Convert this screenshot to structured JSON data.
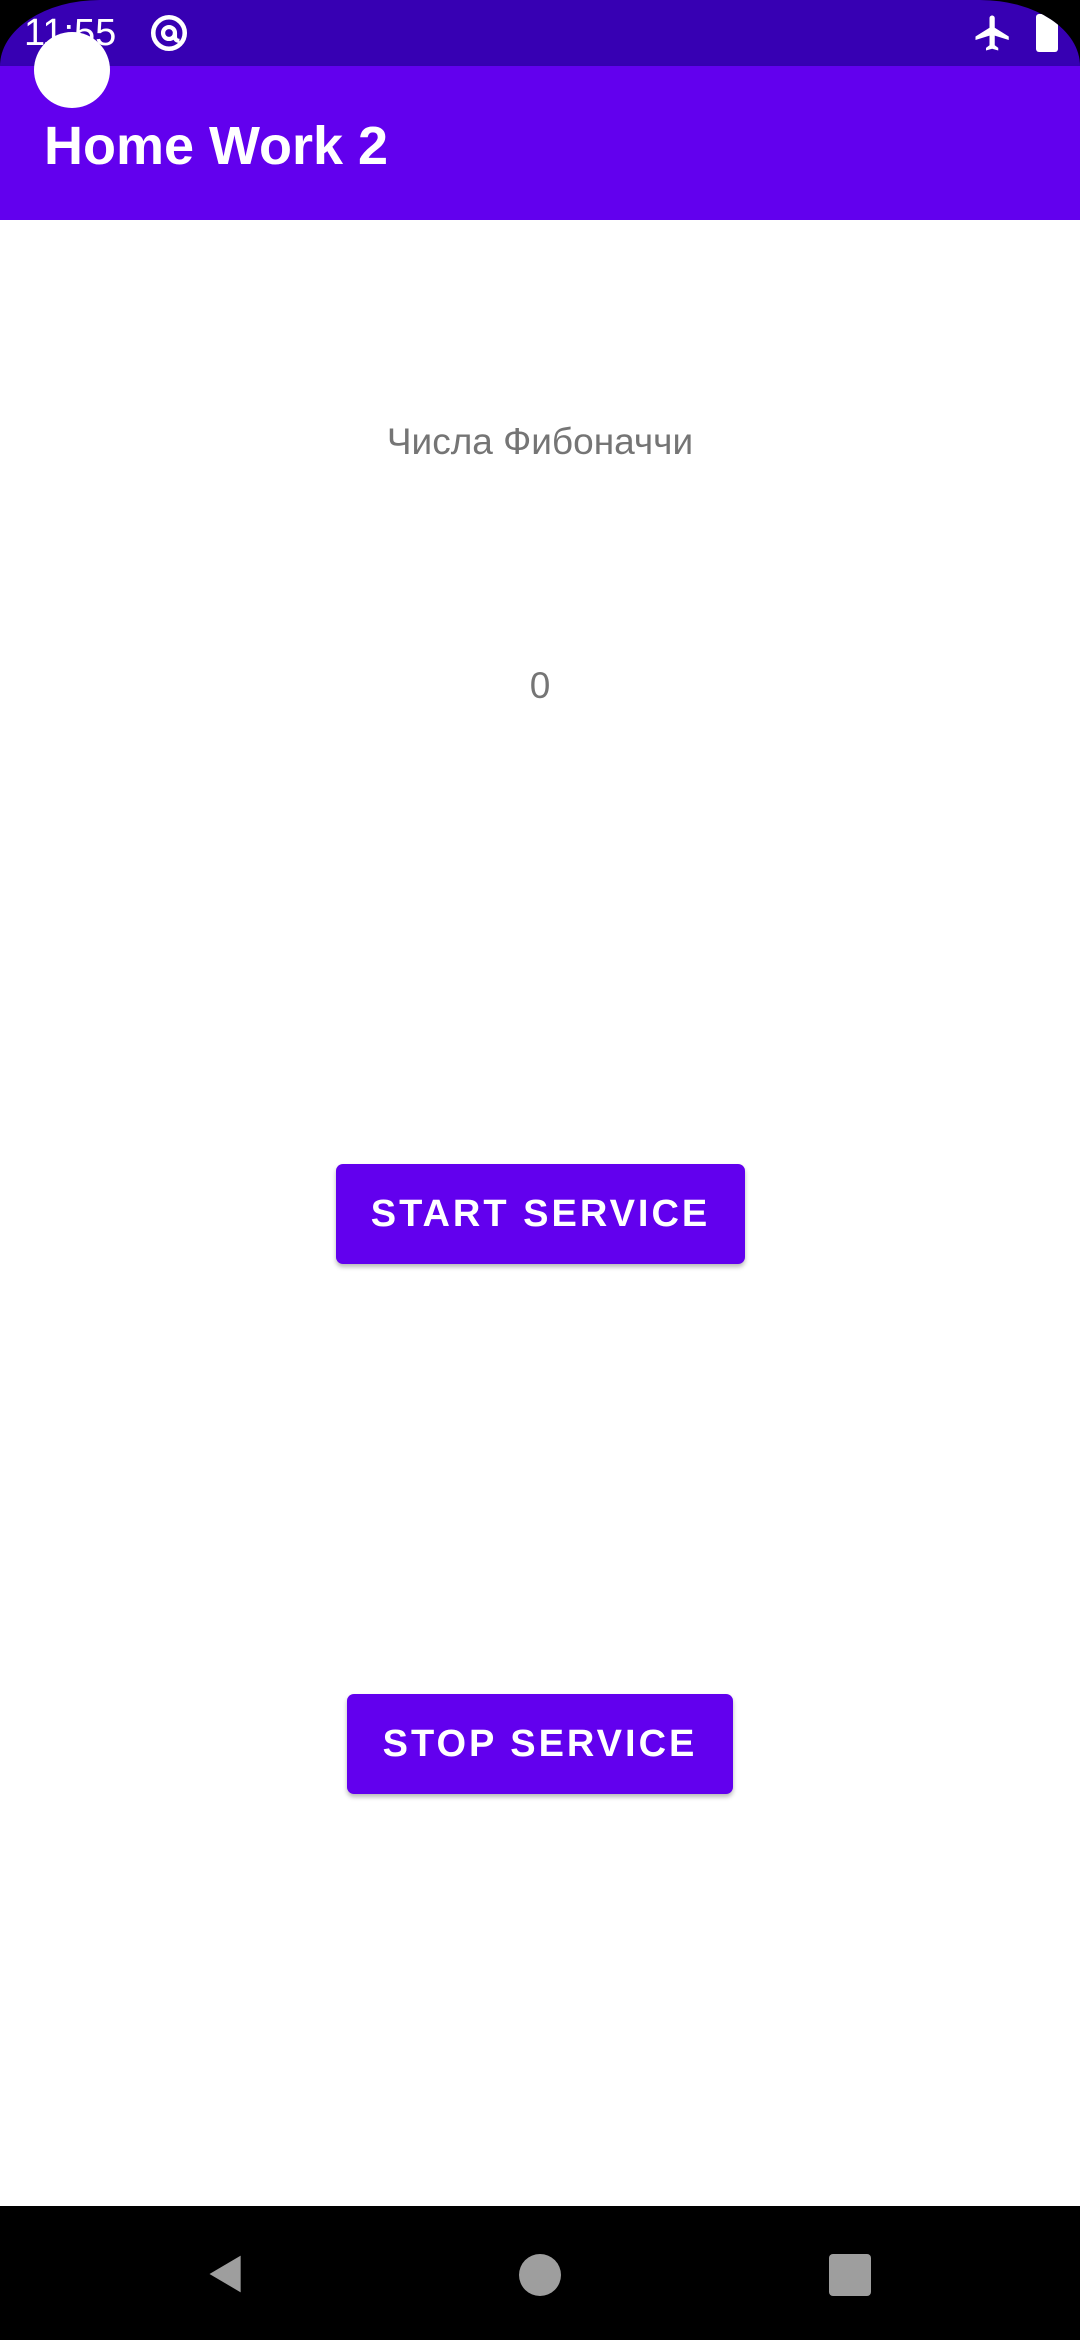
{
  "status_bar": {
    "time": "11:55",
    "icons": [
      "at-sign-icon",
      "airplane-mode-icon",
      "battery-icon"
    ]
  },
  "app_bar": {
    "title": "Home Work 2"
  },
  "main": {
    "title_label": "Числа Фибоначчи",
    "value_label": "0",
    "start_button": "START SERVICE",
    "stop_button": "STOP SERVICE"
  },
  "nav_bar": {
    "icons": [
      "back-icon",
      "home-icon",
      "recents-icon"
    ]
  },
  "colors": {
    "status_bar": "#3700b3",
    "primary": "#6200ee",
    "text_secondary": "#757575",
    "background": "#ffffff"
  }
}
